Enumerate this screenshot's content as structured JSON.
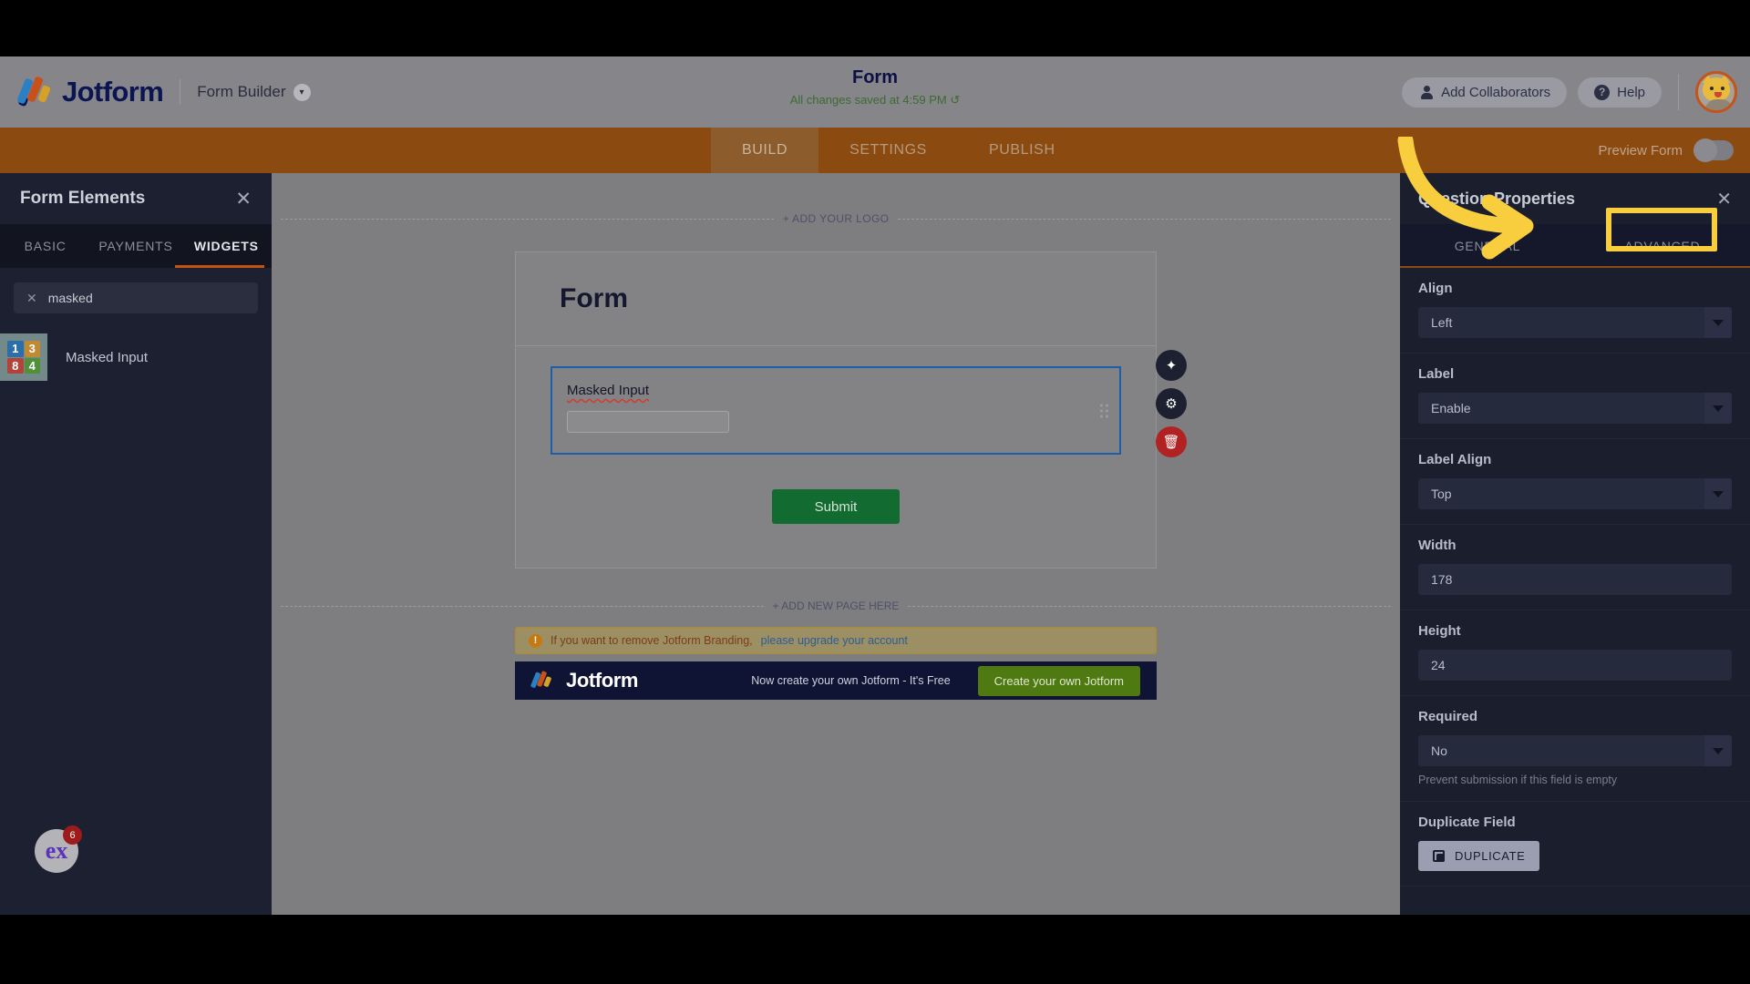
{
  "header": {
    "brand": "Jotform",
    "product_menu": "Form Builder",
    "title": "Form",
    "saved_status": "All changes saved at 4:59 PM ↺",
    "add_collaborators": "Add Collaborators",
    "help": "Help",
    "avatar_name": "cat-avatar"
  },
  "nav": {
    "tabs": [
      {
        "label": "BUILD",
        "active": true
      },
      {
        "label": "SETTINGS",
        "active": false
      },
      {
        "label": "PUBLISH",
        "active": false
      }
    ],
    "preview_label": "Preview Form",
    "preview_on": false
  },
  "left_panel": {
    "title": "Form Elements",
    "close_icon": "close-icon",
    "tabs": [
      {
        "label": "BASIC",
        "active": false
      },
      {
        "label": "PAYMENTS",
        "active": false
      },
      {
        "label": "WIDGETS",
        "active": true
      }
    ],
    "search": {
      "value": "masked",
      "clear_icon": "close-icon"
    },
    "widgets": [
      {
        "label": "Masked Input",
        "icon_name": "masked-input-numgrid-icon",
        "icon_cells": [
          {
            "digit": "1",
            "color": "#2b6ea8"
          },
          {
            "digit": "3",
            "color": "#c08a32"
          },
          {
            "digit": "8",
            "color": "#b2433a"
          },
          {
            "digit": "4",
            "color": "#4f9038"
          }
        ]
      }
    ]
  },
  "canvas": {
    "add_logo": "+ ADD YOUR LOGO",
    "form_title": "Form",
    "field": {
      "label": "Masked Input",
      "input_value": "",
      "drag_handle": "drag-handle-icon",
      "actions": [
        {
          "name": "magic-wand-icon",
          "glyph": "✦"
        },
        {
          "name": "gear-icon",
          "glyph": "⚙"
        },
        {
          "name": "trash-icon",
          "glyph": "🗑"
        }
      ]
    },
    "submit_label": "Submit",
    "add_new_page": "+ ADD NEW PAGE HERE",
    "branding_notice": "If you want to remove Jotform Branding,",
    "branding_link": "please upgrade your account",
    "footer": {
      "brand": "Jotform",
      "tagline": "Now create your own Jotform - It's Free",
      "cta": "Create your own Jotform"
    }
  },
  "right_panel": {
    "title": "Question Properties",
    "close_icon": "close-icon",
    "tabs": [
      {
        "label": "GENERAL",
        "active": false
      },
      {
        "label": "ADVANCED",
        "active": true
      }
    ],
    "properties": [
      {
        "label": "Align",
        "type": "select",
        "value": "Left",
        "hint": ""
      },
      {
        "label": "Label",
        "type": "select",
        "value": "Enable",
        "hint": ""
      },
      {
        "label": "Label Align",
        "type": "select",
        "value": "Top",
        "hint": ""
      },
      {
        "label": "Width",
        "type": "input",
        "value": "178",
        "hint": ""
      },
      {
        "label": "Height",
        "type": "input",
        "value": "24",
        "hint": ""
      },
      {
        "label": "Required",
        "type": "select",
        "value": "No",
        "hint": "Prevent submission if this field is empty"
      }
    ],
    "duplicate_section": {
      "label": "Duplicate Field",
      "button": "DUPLICATE"
    }
  },
  "overlay": {
    "float_widget_text": "ex",
    "float_badge_count": "6"
  },
  "annotation": {
    "highlight_color": "#f8ce3e",
    "target": "ADVANCED"
  }
}
